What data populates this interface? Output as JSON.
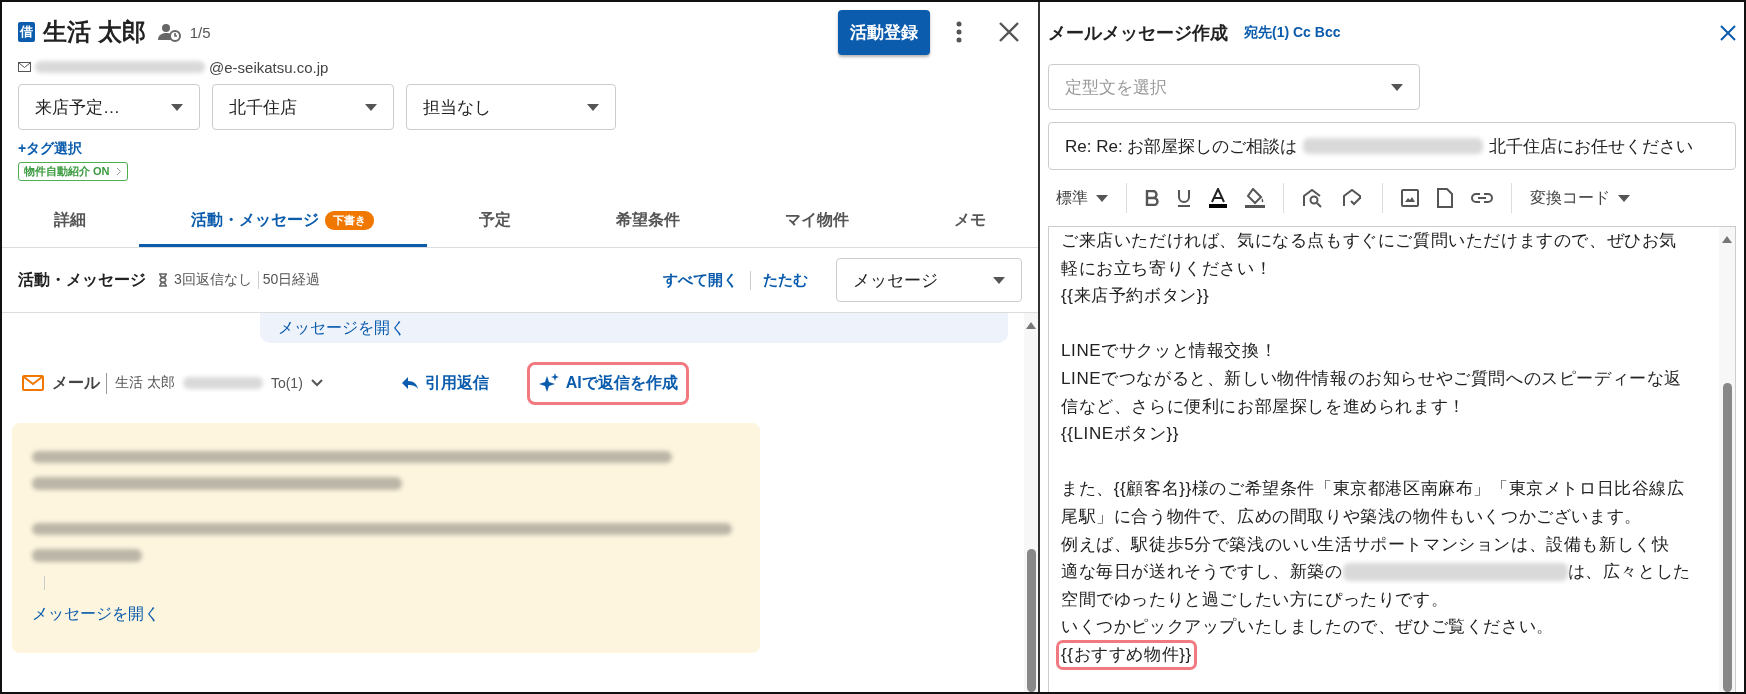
{
  "customer": {
    "badge": "借",
    "name": "生活 太郎",
    "count": "1/5",
    "email_domain": "@e-seikatsu.co.jp"
  },
  "header_actions": {
    "primary": "活動登録"
  },
  "filters": [
    {
      "value": "来店予定…"
    },
    {
      "value": "北千住店"
    },
    {
      "value": "担当なし"
    }
  ],
  "tag_link": "+タグ選択",
  "auto_badge": {
    "label": "物件自動紹介 ON",
    "on": true
  },
  "tabs": [
    {
      "label": "詳細",
      "selected": false
    },
    {
      "label": "活動・メッセージ",
      "selected": true,
      "badge": "下書き"
    },
    {
      "label": "予定",
      "selected": false
    },
    {
      "label": "希望条件",
      "selected": false
    },
    {
      "label": "マイ物件",
      "selected": false
    },
    {
      "label": "メモ",
      "selected": false
    }
  ],
  "section": {
    "title": "活動・メッセージ",
    "no_reply": "3回返信なし",
    "elapsed": "50日経過",
    "expand_all": "すべて開く",
    "collapse": "たたむ",
    "filter": "メッセージ"
  },
  "previous_bubble": {
    "link": "メッセージを開く"
  },
  "mail": {
    "type": "メール",
    "sender": "生活 太郎",
    "to": "To(1)",
    "quote_reply": "引用返信",
    "ai_reply": {
      "label": "AIで返信を作成",
      "highlighted": true
    },
    "open_link": "メッセージを開く"
  },
  "compose": {
    "title": "メールメッセージ作成",
    "recipients": "宛先(1) Cc Bcc",
    "template_placeholder": "定型文を選択",
    "subject_before": "Re: Re: お部屋探しのご相談は",
    "subject_after": "北千住店にお任せください",
    "toolbar": {
      "style": "標準",
      "convert": "変換コード"
    },
    "lines": [
      {
        "kind": "text",
        "text": "ご来店いただければ、気になる点もすぐにご質問いただけますので、ぜひお気"
      },
      {
        "kind": "text",
        "text": "軽にお立ち寄りください！"
      },
      {
        "kind": "text",
        "text": "{{来店予約ボタン}}"
      },
      {
        "kind": "blank"
      },
      {
        "kind": "text",
        "text": "LINEでサクッと情報交換！"
      },
      {
        "kind": "text",
        "text": "LINEでつながると、新しい物件情報のお知らせやご質問へのスピーディーな返"
      },
      {
        "kind": "text",
        "text": "信など、さらに便利にお部屋探しを進められます！"
      },
      {
        "kind": "text",
        "text": "{{LINEボタン}}"
      },
      {
        "kind": "blank"
      },
      {
        "kind": "text",
        "text": "また、{{顧客名}}様のご希望条件「東京都港区南麻布」「東京メトロ日比谷線広"
      },
      {
        "kind": "text",
        "text": "尾駅」に合う物件で、広めの間取りや築浅の物件もいくつかございます。"
      },
      {
        "kind": "text",
        "text": "例えば、駅徒歩5分で築浅のいい生活サポートマンションは、設備も新しく快"
      },
      {
        "kind": "redacted",
        "before": "適な毎日が送れそうですし、新築の",
        "after": "は、広々とした"
      },
      {
        "kind": "text",
        "text": "空間でゆったりと過ごしたい方にぴったりです。"
      },
      {
        "kind": "text",
        "text": "いくつかピックアップいたしましたので、ぜひご覧ください。"
      },
      {
        "kind": "text",
        "text": "{{おすすめ物件}}",
        "highlighted": true
      }
    ]
  }
}
